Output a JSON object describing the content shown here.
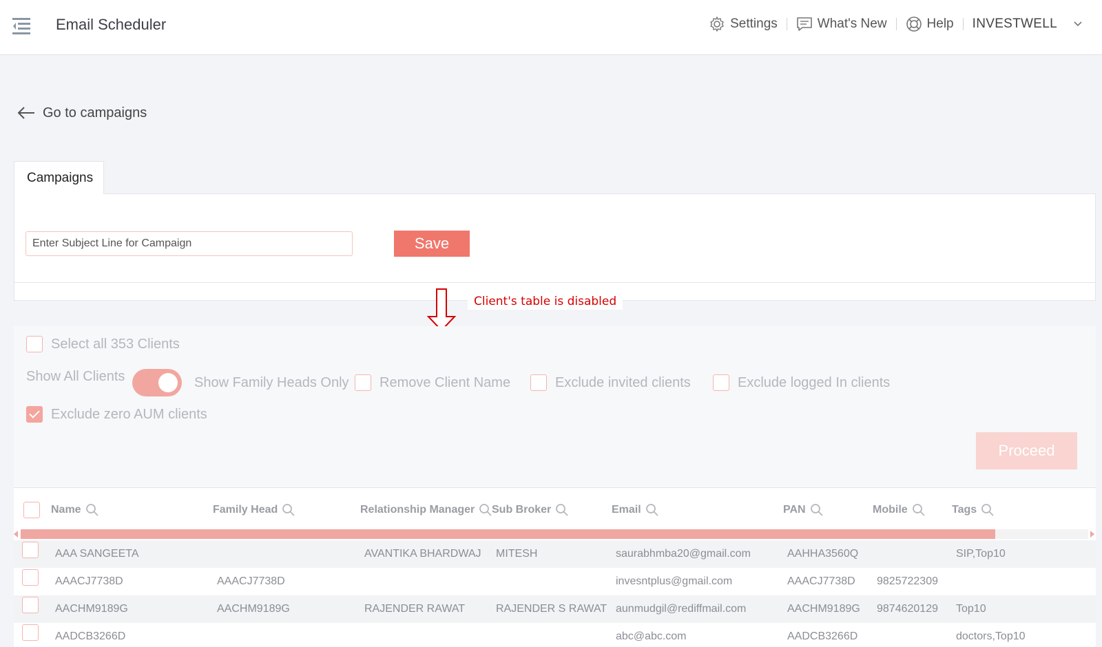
{
  "app": {
    "title": "Email Scheduler"
  },
  "topnav": {
    "settings": "Settings",
    "whats_new": "What's New",
    "help": "Help",
    "account": "INVESTWELL"
  },
  "back_link": "Go to campaigns",
  "tab": {
    "label": "Campaigns"
  },
  "campaign": {
    "subject_placeholder": "Enter Subject Line for Campaign",
    "save_label": "Save"
  },
  "annotation": {
    "text": "Client's table is disabled",
    "color": "#d40000"
  },
  "clients": {
    "select_all": "Select all 353 Clients",
    "show_all": "Show All Clients",
    "show_family_heads": "Show Family Heads Only",
    "remove_client_name": "Remove Client Name",
    "exclude_invited": "Exclude invited clients",
    "exclude_logged_in": "Exclude logged In clients",
    "exclude_zero_aum": "Exclude zero AUM clients",
    "exclude_zero_aum_checked": true,
    "proceed_label": "Proceed",
    "toggle_on": true
  },
  "table": {
    "columns": [
      "Name",
      "Family Head",
      "Relationship Manager",
      "Sub Broker",
      "Email",
      "PAN",
      "Mobile",
      "Tags"
    ],
    "rows": [
      [
        "AAA SANGEETA",
        "",
        "AVANTIKA BHARDWAJ",
        "MITESH",
        "saurabhmba20@gmail.com",
        "AAHHA3560Q",
        "",
        "SIP,Top10"
      ],
      [
        "AAACJ7738D",
        "AAACJ7738D",
        "",
        "",
        "invesntplus@gmail.com",
        "AAACJ7738D",
        "9825722309",
        ""
      ],
      [
        "AACHM9189G",
        "AACHM9189G",
        "RAJENDER RAWAT",
        "RAJENDER S RAWAT",
        "aunmudgil@rediffmail.com",
        "AACHM9189G",
        "9874620129",
        "Top10"
      ],
      [
        "AADCB3266D",
        "",
        "",
        "",
        "abc@abc.com",
        "AADCB3266D",
        "",
        "doctors,Top10"
      ]
    ]
  },
  "colors": {
    "accent": "#f0776b",
    "accent_disabled": "#f4a59e",
    "proceed_disabled": "#f9d4d1"
  }
}
